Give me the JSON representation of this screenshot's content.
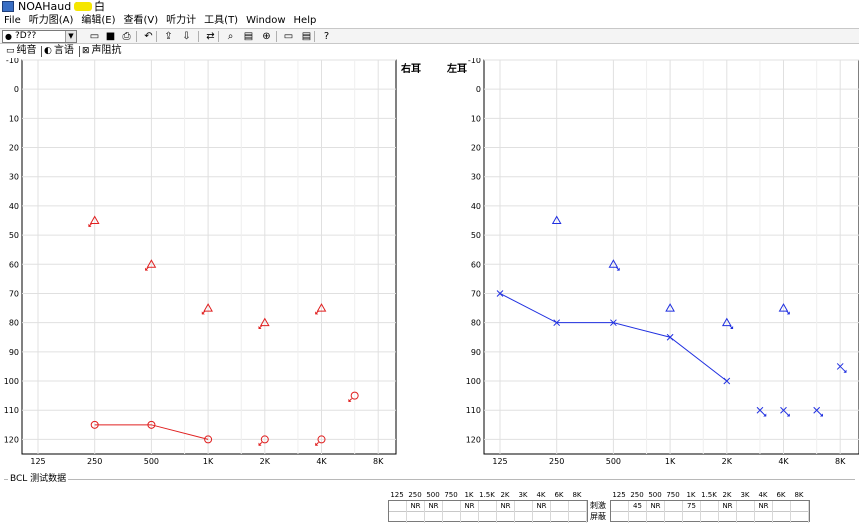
{
  "window": {
    "title_prefix": "NOAHaud 3",
    "title_suffix": "白"
  },
  "menu": [
    "File",
    "听力图(A)",
    "编辑(E)",
    "查看(V)",
    "听力计",
    "工具(T)",
    "Window",
    "Help"
  ],
  "toolbar": {
    "combo_value": "?D??",
    "buttons": [
      {
        "name": "new-icon",
        "glyph": "▭"
      },
      {
        "name": "save-icon",
        "glyph": "■"
      },
      {
        "name": "print-icon",
        "glyph": "⎙"
      },
      {
        "name": "undo-icon",
        "glyph": "↶"
      },
      {
        "name": "export-icon",
        "glyph": "⇪"
      },
      {
        "name": "import-icon",
        "glyph": "⇩"
      },
      {
        "name": "swap-ears-icon",
        "glyph": "⇄"
      },
      {
        "name": "zoom-icon",
        "glyph": "⌕"
      },
      {
        "name": "compare-icon",
        "glyph": "▤"
      },
      {
        "name": "magnify-icon",
        "glyph": "⊕"
      },
      {
        "name": "view-one-icon",
        "glyph": "▭"
      },
      {
        "name": "view-two-icon",
        "glyph": "▤"
      },
      {
        "name": "help-icon",
        "glyph": "?"
      }
    ]
  },
  "tabs": [
    {
      "name": "tab-pure-tone",
      "label": "纯音",
      "glyph": "▭"
    },
    {
      "name": "tab-speech",
      "label": "言语",
      "glyph": "◐"
    },
    {
      "name": "tab-impedance",
      "label": "声阻抗",
      "glyph": "⊠"
    }
  ],
  "labels": {
    "right_ear": "右耳",
    "left_ear": "左耳"
  },
  "colors": {
    "right": "#e02020",
    "left": "#2030e0",
    "grid": "#e0e0e0",
    "frame": "#000000"
  },
  "chart_data": [
    {
      "type": "scatter",
      "ear": "right",
      "title": "",
      "xlabel": "",
      "ylabel": "",
      "x_ticks": [
        "125",
        "250",
        "500",
        "1K",
        "2K",
        "4K",
        "8K"
      ],
      "y_ticks": [
        "-10",
        "0",
        "10",
        "20",
        "30",
        "40",
        "50",
        "60",
        "70",
        "80",
        "90",
        "100",
        "110",
        "120"
      ],
      "ylim": [
        -10,
        125
      ],
      "y_inverted": true,
      "grid": true,
      "series": [
        {
          "symbol": "triangle",
          "masked": true,
          "connected": false,
          "points": [
            [
              250,
              45
            ],
            [
              500,
              60
            ],
            [
              1000,
              75
            ],
            [
              2000,
              80
            ],
            [
              4000,
              75
            ]
          ]
        },
        {
          "symbol": "circle",
          "masked": false,
          "connected": true,
          "points": [
            [
              250,
              115
            ],
            [
              500,
              115
            ],
            [
              1000,
              120
            ]
          ]
        },
        {
          "symbol": "circle",
          "masked": true,
          "connected": false,
          "points": [
            [
              2000,
              120
            ],
            [
              4000,
              120
            ],
            [
              6000,
              105
            ]
          ]
        }
      ]
    },
    {
      "type": "scatter",
      "ear": "left",
      "title": "",
      "xlabel": "",
      "ylabel": "",
      "x_ticks": [
        "125",
        "250",
        "500",
        "1K",
        "2K",
        "4K",
        "8K"
      ],
      "y_ticks": [
        "-10",
        "0",
        "10",
        "20",
        "30",
        "40",
        "50",
        "60",
        "70",
        "80",
        "90",
        "100",
        "110",
        "120"
      ],
      "ylim": [
        -10,
        125
      ],
      "y_inverted": true,
      "grid": true,
      "series": [
        {
          "symbol": "triangle",
          "masked": false,
          "connected": false,
          "points": [
            [
              250,
              45
            ],
            [
              1000,
              75
            ]
          ]
        },
        {
          "symbol": "triangle",
          "masked": true,
          "connected": false,
          "points": [
            [
              500,
              60
            ],
            [
              2000,
              80
            ],
            [
              4000,
              75
            ]
          ]
        },
        {
          "symbol": "cross",
          "masked": false,
          "connected": true,
          "points": [
            [
              125,
              70
            ],
            [
              250,
              80
            ],
            [
              500,
              80
            ],
            [
              1000,
              85
            ],
            [
              2000,
              100
            ]
          ]
        },
        {
          "symbol": "cross",
          "masked": true,
          "connected": false,
          "points": [
            [
              3000,
              110
            ],
            [
              4000,
              110
            ],
            [
              6000,
              110
            ],
            [
              8000,
              95
            ]
          ]
        }
      ]
    }
  ],
  "bcl": {
    "caption": "BCL 测试数据",
    "freq_headers": [
      "125",
      "250",
      "500",
      "750",
      "1K",
      "1.5K",
      "2K",
      "3K",
      "4K",
      "6K",
      "8K"
    ],
    "right_row1": [
      "",
      "NR",
      "NR",
      "",
      "NR",
      "",
      "NR",
      "",
      "NR",
      "",
      ""
    ],
    "right_row2": [
      "",
      "",
      "",
      "",
      "",
      "",
      "",
      "",
      "",
      "",
      ""
    ],
    "row_labels": [
      "刺激",
      "屏蔽"
    ],
    "left_row1": [
      "",
      "45",
      "NR",
      "",
      "75",
      "",
      "NR",
      "",
      "NR",
      "",
      ""
    ],
    "left_row2": [
      "",
      "",
      "",
      "",
      "",
      "",
      "",
      "",
      "",
      "",
      ""
    ]
  }
}
